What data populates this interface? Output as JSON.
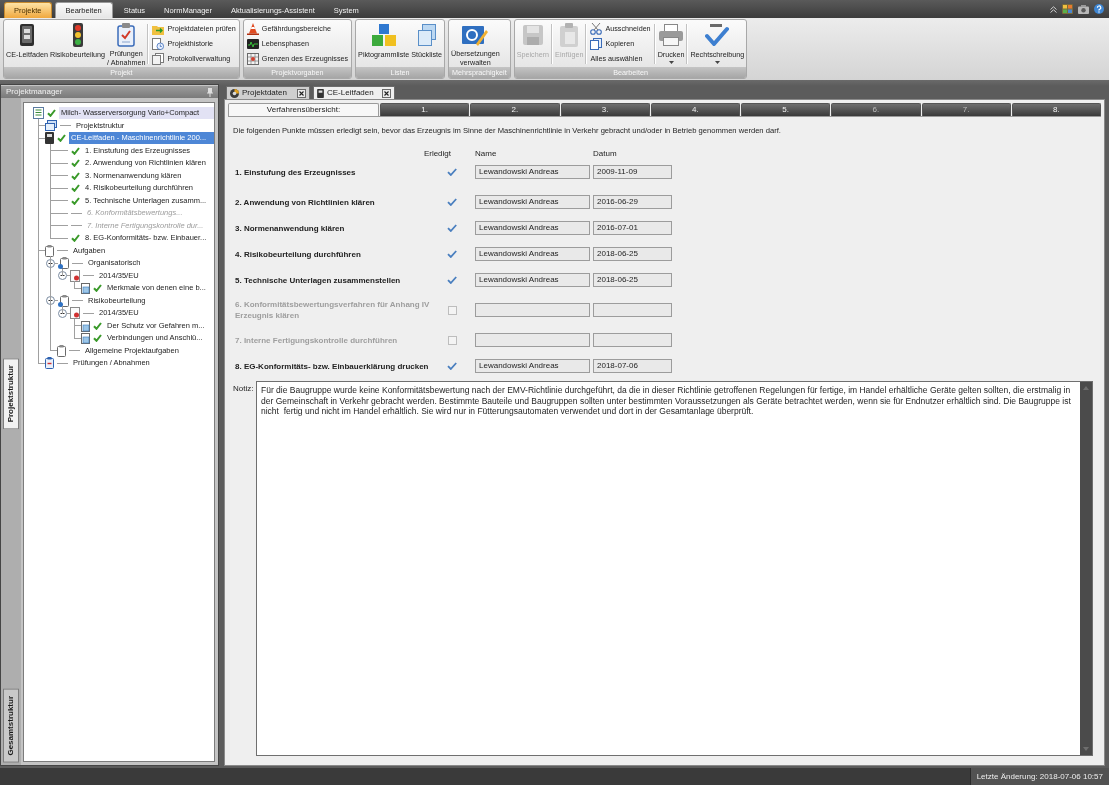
{
  "ribbon_tabs": [
    {
      "label": "Projekte",
      "kind": "application",
      "selected": false
    },
    {
      "label": "Bearbeiten",
      "kind": "tab",
      "selected": true
    },
    {
      "label": "Status",
      "kind": "tab",
      "selected": false
    },
    {
      "label": "NormManager",
      "kind": "tab",
      "selected": false
    },
    {
      "label": "Aktualisierungs-Assistent",
      "kind": "tab",
      "selected": false
    },
    {
      "label": "System",
      "kind": "tab",
      "selected": false
    }
  ],
  "ribbon_groups": [
    {
      "label": "Projekt",
      "separated": false,
      "buttons": [
        {
          "label": "CE-Leitfaden",
          "kind": "large",
          "disabled": false,
          "dropdown": false
        },
        {
          "label": "Risikobeurteilung",
          "kind": "large",
          "disabled": false,
          "dropdown": false
        },
        {
          "label": "Prüfungen\n/ Abnahmen",
          "kind": "large",
          "disabled": false,
          "dropdown": false
        },
        {
          "label": "Projektdateien prüfen",
          "kind": "small",
          "disabled": false,
          "dropdown": false
        },
        {
          "label": "Projekthistorie",
          "kind": "small",
          "disabled": false,
          "dropdown": false
        },
        {
          "label": "Protokollverwaltung",
          "kind": "small",
          "disabled": false,
          "dropdown": false
        }
      ]
    },
    {
      "label": "Projektvorgaben",
      "buttons": [
        {
          "label": "Gefährdungsbereiche",
          "kind": "small",
          "disabled": false,
          "dropdown": false
        },
        {
          "label": "Lebensphasen",
          "kind": "small",
          "disabled": false,
          "dropdown": false
        },
        {
          "label": "Grenzen des Erzeugnisses",
          "kind": "small",
          "disabled": false,
          "dropdown": false
        }
      ]
    },
    {
      "label": "Listen",
      "separated": false,
      "buttons": [
        {
          "label": "Piktogrammliste",
          "kind": "large",
          "disabled": false,
          "dropdown": false
        },
        {
          "label": "Stückliste",
          "kind": "large",
          "disabled": false,
          "dropdown": false
        }
      ]
    },
    {
      "label": "Mehrsprachigkeit",
      "buttons": [
        {
          "label": "Übersetzungen\nverwalten",
          "kind": "large",
          "disabled": false,
          "dropdown": false
        }
      ]
    },
    {
      "label": "Bearbeiten",
      "separated": true,
      "buttons": [
        {
          "label": "Speichern",
          "kind": "large",
          "disabled": true,
          "dropdown": false
        },
        {
          "label": "Einfügen",
          "kind": "large",
          "disabled": true,
          "dropdown": false
        },
        {
          "label": "Ausschneiden",
          "kind": "small",
          "disabled": false,
          "dropdown": false
        },
        {
          "label": "Kopieren",
          "kind": "small",
          "disabled": false,
          "dropdown": false
        },
        {
          "label": "Alles auswählen",
          "kind": "small",
          "disabled": false,
          "dropdown": false
        },
        {
          "label": "Drucken",
          "kind": "large",
          "disabled": false,
          "dropdown": true
        },
        {
          "label": "Rechtschreibung",
          "kind": "large",
          "disabled": false,
          "dropdown": true
        }
      ]
    }
  ],
  "project_manager": {
    "title": "Projektmanager",
    "side_tabs": [
      {
        "label": "Projektstruktur",
        "selected": true
      },
      {
        "label": "Gesamtstruktur",
        "selected": false
      }
    ],
    "tree": [
      {
        "label": "Milch- Wasserversorgung Vario+Compact",
        "kind": "project",
        "done": true,
        "disabled": false,
        "selected": false,
        "highlighted": true,
        "children": [
          {
            "label": "Projektstruktur",
            "kind": "structure",
            "done": false,
            "disabled": false,
            "selected": false,
            "highlighted": false
          },
          {
            "label": "CE-Leitfaden - Maschinenrichtlinie 200...",
            "kind": "guide",
            "done": true,
            "disabled": false,
            "selected": true,
            "highlighted": false,
            "children": [
              {
                "label": "1. Einstufung des Erzeugnisses",
                "kind": "step",
                "done": true,
                "disabled": false,
                "selected": false,
                "highlighted": false
              },
              {
                "label": "2. Anwendung von Richtlinien klären",
                "kind": "step",
                "done": true,
                "disabled": false,
                "selected": false,
                "highlighted": false
              },
              {
                "label": "3. Normenanwendung klären",
                "kind": "step",
                "done": true,
                "disabled": false,
                "selected": false,
                "highlighted": false
              },
              {
                "label": "4. Risikobeurteilung durchführen",
                "kind": "step",
                "done": true,
                "disabled": false,
                "selected": false,
                "highlighted": false
              },
              {
                "label": "5. Technische Unterlagen zusamm...",
                "kind": "step",
                "done": true,
                "disabled": false,
                "selected": false,
                "highlighted": false
              },
              {
                "label": "6. Konformitätsbewertungs...",
                "kind": "step",
                "done": false,
                "disabled": true,
                "selected": false,
                "highlighted": false
              },
              {
                "label": "7. Interne Fertigungskontrolle dur...",
                "kind": "step",
                "done": false,
                "disabled": true,
                "selected": false,
                "highlighted": false
              },
              {
                "label": "8. EG-Konformitäts- bzw. Einbauer...",
                "kind": "step",
                "done": true,
                "disabled": false,
                "selected": false,
                "highlighted": false
              }
            ]
          },
          {
            "label": "Aufgaben",
            "kind": "tasks",
            "done": false,
            "disabled": false,
            "selected": false,
            "highlighted": false,
            "children": [
              {
                "label": "Organisatorisch",
                "kind": "task-group",
                "done": false,
                "disabled": false,
                "selected": false,
                "highlighted": false,
                "expanded": true,
                "children": [
                  {
                    "label": "2014/35/EU",
                    "kind": "directive",
                    "done": false,
                    "disabled": false,
                    "selected": false,
                    "highlighted": false,
                    "expanded": true,
                    "children": [
                      {
                        "label": "Merkmale von denen eine b...",
                        "kind": "task",
                        "done": true,
                        "disabled": false,
                        "selected": false,
                        "highlighted": false
                      }
                    ]
                  }
                ]
              },
              {
                "label": "Risikobeurteilung",
                "kind": "task-group",
                "done": false,
                "disabled": false,
                "selected": false,
                "highlighted": false,
                "expanded": true,
                "children": [
                  {
                    "label": "2014/35/EU",
                    "kind": "directive",
                    "done": false,
                    "disabled": false,
                    "selected": false,
                    "highlighted": false,
                    "expanded": true,
                    "children": [
                      {
                        "label": "Der Schutz vor Gefahren m...",
                        "kind": "task",
                        "done": true,
                        "disabled": false,
                        "selected": false,
                        "highlighted": false
                      },
                      {
                        "label": "Verbindungen und Anschlü...",
                        "kind": "task",
                        "done": true,
                        "disabled": false,
                        "selected": false,
                        "highlighted": false
                      }
                    ]
                  }
                ]
              },
              {
                "label": "Allgemeine Projektaufgaben",
                "kind": "tasks",
                "done": false,
                "disabled": false,
                "selected": false,
                "highlighted": false
              }
            ]
          },
          {
            "label": "Prüfungen / Abnahmen",
            "kind": "tests",
            "done": false,
            "disabled": false,
            "selected": false,
            "highlighted": false
          }
        ]
      }
    ]
  },
  "document_tabs": [
    {
      "label": "Projektdaten",
      "selected": false
    },
    {
      "label": "CE-Leitfaden",
      "selected": true
    }
  ],
  "guide": {
    "tabs": [
      {
        "label": "Verfahrensübersicht:",
        "selected": true,
        "disabled": false
      },
      {
        "label": "1.",
        "selected": false,
        "disabled": false
      },
      {
        "label": "2.",
        "selected": false,
        "disabled": false
      },
      {
        "label": "3.",
        "selected": false,
        "disabled": false
      },
      {
        "label": "4.",
        "selected": false,
        "disabled": false
      },
      {
        "label": "5.",
        "selected": false,
        "disabled": false
      },
      {
        "label": "6.",
        "selected": false,
        "disabled": true
      },
      {
        "label": "7.",
        "selected": false,
        "disabled": true
      },
      {
        "label": "8.",
        "selected": false,
        "disabled": false
      }
    ],
    "intro": "Die folgenden Punkte müssen erledigt sein, bevor das Erzeugnis im Sinne der Maschinenrichtlinie in Verkehr gebracht und/oder in Betrieb genommen werden darf.",
    "column_headers": [
      "Erledigt",
      "Name",
      "Datum"
    ],
    "steps": [
      {
        "label": "1. Einstufung des Erzeugnisses",
        "done": true,
        "disabled": false,
        "name": "Lewandowski Andreas",
        "date": "2009-11-09"
      },
      {
        "label": "2. Anwendung von Richtlinien klären",
        "done": true,
        "disabled": false,
        "name": "Lewandowski Andreas",
        "date": "2016-06-29"
      },
      {
        "label": "3. Normenanwendung klären",
        "done": true,
        "disabled": false,
        "name": "Lewandowski Andreas",
        "date": "2016-07-01"
      },
      {
        "label": "4. Risikobeurteilung durchführen",
        "done": true,
        "disabled": false,
        "name": "Lewandowski Andreas",
        "date": "2018-06-25"
      },
      {
        "label": "5. Technische Unterlagen zusammenstellen",
        "done": true,
        "disabled": false,
        "name": "Lewandowski Andreas",
        "date": "2018-06-25"
      },
      {
        "label": "6. Konformitätsbewertungsverfahren für Anhang IV Erzeugnis klären",
        "done": false,
        "disabled": true
      },
      {
        "label": "7. Interne Fertigungskontrolle durchführen",
        "done": false,
        "disabled": true
      },
      {
        "label": "8. EG-Konformitäts- bzw. Einbauerklärung drucken",
        "done": true,
        "disabled": false,
        "name": "Lewandowski Andreas",
        "date": "2018-07-06"
      }
    ],
    "note_label": "Notiz:",
    "note": "Für die Baugruppe wurde keine Konformitätsbewertung nach der EMV-Richtlinie durchgeführt, da die in dieser Richtlinie getroffenen Regelungen für fertige, im Handel erhältliche Geräte gelten sollten, die erstmalig in der Gemeinschaft in Verkehr gebracht werden. Bestimmte Bauteile und Baugruppen sollten unter bestimmten Voraussetzungen als Geräte betrachtet werden, wenn sie für Endnutzer erhältlich sind. Die Baugruppe ist nicht  fertig und nicht im Handel erhältlich. Sie wird nur in Fütterungsautomaten verwendet und dort in der Gesamtanlage überprüft."
  },
  "status_bar": {
    "last_change": "Letzte Änderung: 2018-07-06 10:57"
  }
}
